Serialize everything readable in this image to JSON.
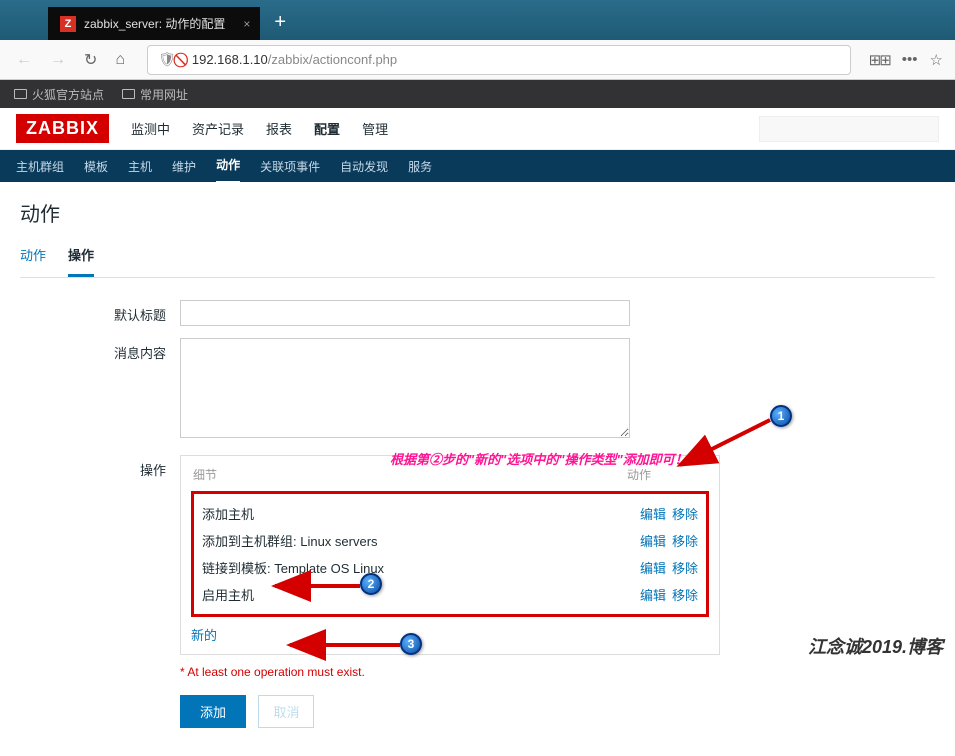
{
  "browser": {
    "tab_icon_letter": "Z",
    "tab_title": "zabbix_server: 动作的配置",
    "url_host": "192.168.1.10",
    "url_path": "/zabbix/actionconf.php",
    "bookmarks": [
      {
        "label": "火狐官方站点"
      },
      {
        "label": "常用网址"
      }
    ]
  },
  "zabbix": {
    "logo": "ZABBIX",
    "top_nav": [
      {
        "label": "监测中",
        "active": false
      },
      {
        "label": "资产记录",
        "active": false
      },
      {
        "label": "报表",
        "active": false
      },
      {
        "label": "配置",
        "active": true
      },
      {
        "label": "管理",
        "active": false
      }
    ],
    "sub_nav": [
      {
        "label": "主机群组",
        "active": false
      },
      {
        "label": "模板",
        "active": false
      },
      {
        "label": "主机",
        "active": false
      },
      {
        "label": "维护",
        "active": false
      },
      {
        "label": "动作",
        "active": true
      },
      {
        "label": "关联项事件",
        "active": false
      },
      {
        "label": "自动发现",
        "active": false
      },
      {
        "label": "服务",
        "active": false
      }
    ],
    "page_title": "动作",
    "inner_tabs": [
      {
        "label": "动作",
        "active": false
      },
      {
        "label": "操作",
        "active": true
      }
    ],
    "form": {
      "default_title_label": "默认标题",
      "default_title_value": "",
      "message_label": "消息内容",
      "message_value": "",
      "operations_label": "操作",
      "col_detail": "细节",
      "col_action": "动作",
      "operations": [
        {
          "text": "添加主机",
          "edit": "编辑",
          "remove": "移除"
        },
        {
          "text": "添加到主机群组: Linux servers",
          "edit": "编辑",
          "remove": "移除"
        },
        {
          "text": "链接到模板: Template OS Linux",
          "edit": "编辑",
          "remove": "移除"
        },
        {
          "text": "启用主机",
          "edit": "编辑",
          "remove": "移除"
        }
      ],
      "new_link": "新的",
      "error_msg": "At least one operation must exist.",
      "add_button": "添加",
      "cancel_button": "取消"
    }
  },
  "annotations": {
    "hint_text": "根据第②步的\"新的\"选项中的\"操作类型\"添加即可！",
    "c1": "1",
    "c2": "2",
    "c3": "3"
  },
  "watermark": "江念诚2019.博客"
}
